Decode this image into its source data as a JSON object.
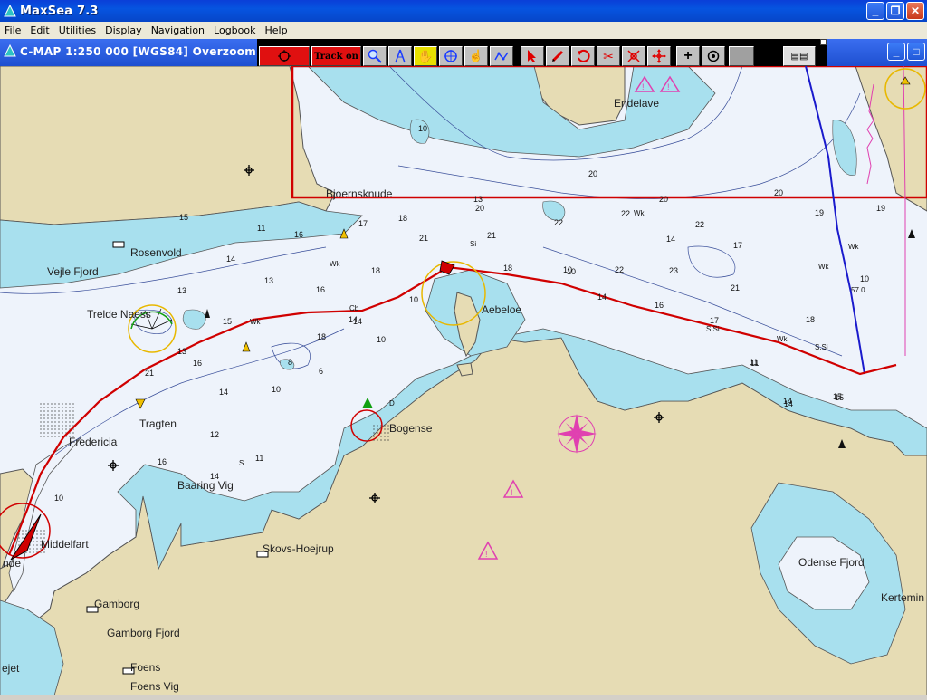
{
  "window": {
    "title": "MaxSea 7.3",
    "minimize": "_",
    "maximize": "❐",
    "close": "✕"
  },
  "menu": [
    "File",
    "Edit",
    "Utilities",
    "Display",
    "Navigation",
    "Logbook",
    "Help"
  ],
  "chart_window": {
    "title": "C-MAP  1:250 000 [WGS84]    Overzoom"
  },
  "toolbar": {
    "track_label": "Track on"
  },
  "map": {
    "places": [
      "Endelave",
      "Bjoernsknude",
      "Rosenvold",
      "Vejle Fjord",
      "Trelde Naess",
      "Aebeloe",
      "Bogense",
      "Tragten",
      "Fredericia",
      "Baaring Vig",
      "Middelfart",
      "Skovs-Hoejrup",
      "Gamborg",
      "Gamborg Fjord",
      "Foens",
      "Foens Vig",
      "Odense Fjord",
      "Kertemin",
      "ejet",
      "nde"
    ],
    "soundings": [
      "13",
      "22",
      "22",
      "22",
      "20",
      "17",
      "18",
      "21",
      "21",
      "18",
      "10",
      "14",
      "17",
      "14",
      "19",
      "15",
      "16",
      "14",
      "13",
      "14",
      "13",
      "16",
      "18",
      "10",
      "22",
      "23",
      "16",
      "21",
      "14",
      "18",
      "15",
      "11",
      "17",
      "19",
      "21",
      "14",
      "16",
      "8",
      "10",
      "6",
      "14",
      "15",
      "11",
      "14",
      "16",
      "12",
      "14",
      "11",
      "15",
      "10",
      "18",
      "11",
      "10",
      "13",
      "20",
      "20",
      "20",
      "10",
      "10",
      "10"
    ],
    "labels": [
      "Wk",
      "Wk",
      "Wk",
      "Wk",
      "Wk",
      "Wk",
      "Cb",
      "Si",
      "S.Si",
      "S",
      "S.Si",
      "57.0",
      "D"
    ]
  }
}
